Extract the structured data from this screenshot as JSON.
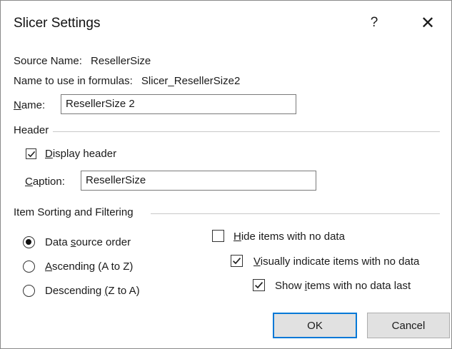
{
  "dialog": {
    "title": "Slicer Settings",
    "help_glyph": "?",
    "close_glyph": "✕"
  },
  "source": {
    "source_name_label": "Source Name:",
    "source_name_value": "ResellerSize",
    "formula_name_label": "Name to use in formulas:",
    "formula_name_value": "Slicer_ResellerSize2"
  },
  "name_field": {
    "label_accel": "N",
    "label_rest": "ame:",
    "value": "ResellerSize 2"
  },
  "header_group": {
    "title": "Header",
    "display_header": {
      "accel": "D",
      "rest": "isplay header",
      "checked": true
    },
    "caption": {
      "label_accel": "C",
      "label_rest": "aption:",
      "value": "ResellerSize"
    }
  },
  "sorting_group": {
    "title": "Item Sorting and Filtering",
    "radios": [
      {
        "pre": "Data ",
        "accel": "s",
        "post": "ource order",
        "selected": true
      },
      {
        "pre": "",
        "accel": "A",
        "post": "scending (A to Z)",
        "selected": false
      },
      {
        "pre": "Descending ",
        "accel": "(",
        "post": "Z to A)",
        "selected": false
      }
    ],
    "checkboxes": [
      {
        "pre": "",
        "accel": "H",
        "post": "ide items with no data",
        "checked": false
      },
      {
        "pre": "",
        "accel": "V",
        "post": "isually indicate items with no data",
        "checked": true
      },
      {
        "pre": "Show ",
        "accel": "i",
        "post": "tems with no data last",
        "checked": true
      }
    ]
  },
  "buttons": {
    "ok": "OK",
    "cancel": "Cancel"
  },
  "colors": {
    "default_button_border": "#0078d7",
    "button_face": "#e1e1e1"
  }
}
